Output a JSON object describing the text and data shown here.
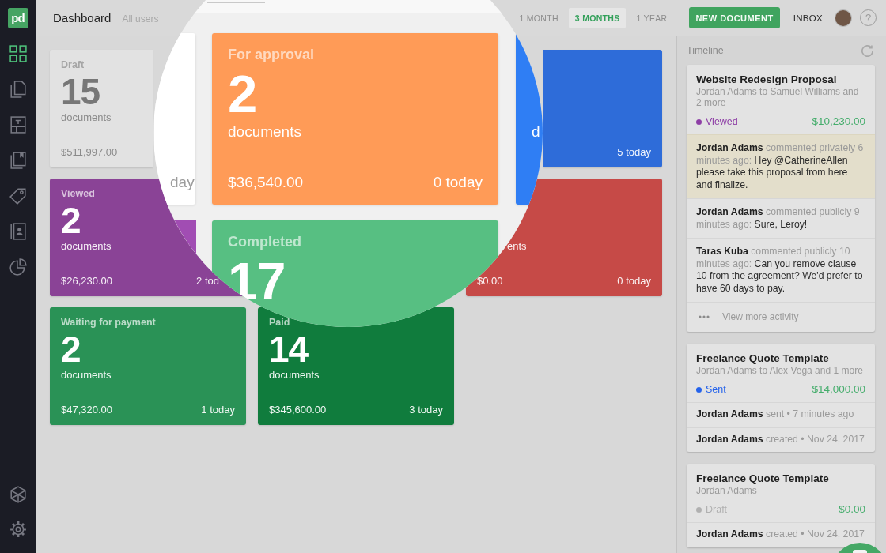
{
  "sidebar": {
    "logo": "pd",
    "items": [
      {
        "kind": "grid",
        "selected": true
      },
      {
        "kind": "pages",
        "selected": false
      },
      {
        "kind": "layout",
        "selected": false
      },
      {
        "kind": "book",
        "selected": false
      },
      {
        "kind": "tag",
        "selected": false
      },
      {
        "kind": "contact",
        "selected": false
      },
      {
        "kind": "pie",
        "selected": false
      }
    ],
    "footer_items": [
      {
        "kind": "cube",
        "selected": false
      },
      {
        "kind": "gear",
        "selected": false
      }
    ]
  },
  "top_bar": {
    "title": "Dashboard",
    "filter": {
      "placeholder": "All users"
    },
    "periods": [
      {
        "label": "1 MONTH",
        "selected": false
      },
      {
        "label": "3 MONTHS",
        "selected": true
      },
      {
        "label": "1 YEAR",
        "selected": false
      }
    ],
    "new_document": "NEW DOCUMENT",
    "inbox": "INBOX",
    "help": "?"
  },
  "status_cards": [
    {
      "title": "Draft",
      "count": "15",
      "unit": "documents",
      "amount": "$511,997.00",
      "color": "#e2e2e2"
    },
    {
      "today": "5 today",
      "color": "#2e6cd9"
    },
    {
      "title": "Viewed",
      "count": "2",
      "unit": "documents",
      "amount": "$26,230.00",
      "today": "2 tod",
      "color": "#8a4396"
    },
    {
      "unit": "ents",
      "amount": "$0.00",
      "today": "0 today",
      "color": "#c64a47"
    },
    {
      "title": "Waiting for payment",
      "count": "2",
      "unit": "documents",
      "amount": "$47,320.00",
      "today": "1 today",
      "color": "#2a9256"
    },
    {
      "title": "Paid",
      "count": "14",
      "unit": "documents",
      "amount": "$345,600.00",
      "today": "3 today",
      "color": "#107c3d"
    }
  ],
  "magnifier": {
    "cards": [
      {
        "today": "day",
        "color": "#ffffff"
      },
      {
        "color": "#a14db3"
      },
      {
        "title": "For approval",
        "count": "2",
        "unit": "documents",
        "amount": "$36,540.00",
        "today": "0 today",
        "color": "#ff9b57"
      },
      {
        "title": "Completed",
        "count": "17",
        "color": "#57bf82"
      },
      {
        "unit": "d",
        "color": "#2f7ef4"
      }
    ]
  },
  "timeline": {
    "title": "Timeline",
    "cards": [
      {
        "title": "Website Redesign Proposal",
        "subtitle": "Jordan Adams to Samuel Williams and 2 more",
        "status": {
          "label": "Viewed",
          "color": "#8e3fa6"
        },
        "amount": "$10,230.00",
        "activities": [
          {
            "author": "Jordan Adams",
            "action": "commented privately 6 minutes ago:",
            "text": "Hey @CatherineAllen please take this proposal from here and finalize.",
            "highlighted": true
          },
          {
            "author": "Jordan Adams",
            "action": "commented publicly 9 minutes ago:",
            "text": "Sure, Leroy!",
            "highlighted": false
          },
          {
            "author": "Taras Kuba",
            "action": "commented publicly 10 minutes ago:",
            "text": "Can you remove clause 10 from the agreement? We'd prefer to have 60 days to pay.",
            "highlighted": false
          }
        ],
        "more": "View more activity"
      },
      {
        "title": "Freelance Quote Template",
        "subtitle": "Jordan Adams to Alex Vega and 1 more",
        "status": {
          "label": "Sent",
          "color": "#2563eb"
        },
        "amount": "$14,000.00",
        "activities": [
          {
            "author": "Jordan Adams",
            "action": "sent • 7 minutes ago",
            "highlighted": false
          },
          {
            "author": "Jordan Adams",
            "action": "created • Nov 24, 2017",
            "highlighted": false
          }
        ]
      },
      {
        "title": "Freelance Quote Template",
        "subtitle": "Jordan Adams",
        "status": {
          "label": "Draft",
          "color": "#b0b0b0"
        },
        "amount": "$0.00",
        "activities": [
          {
            "author": "Jordan Adams",
            "action": "created • Nov 24, 2017",
            "highlighted": false
          }
        ]
      }
    ]
  }
}
